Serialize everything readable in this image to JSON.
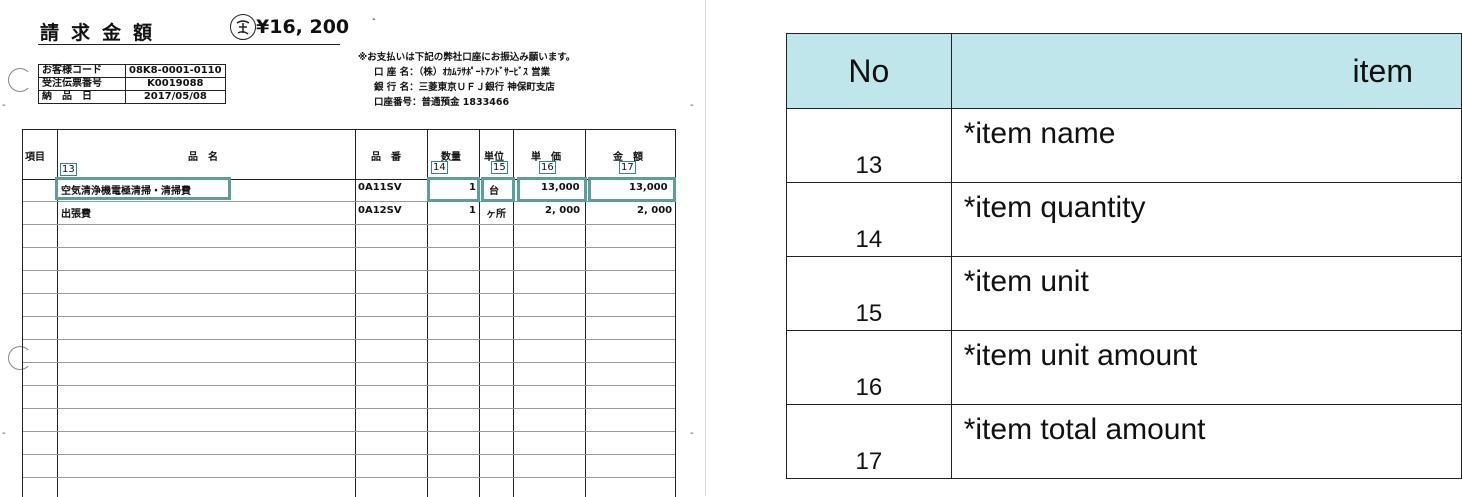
{
  "invoice": {
    "title": "請求金額",
    "stamp_text": "星ん",
    "amount": "¥16, 200",
    "info": [
      {
        "label": "お客様コード",
        "value": "08K8-0001-0110"
      },
      {
        "label": "受注伝票番号",
        "value": "K0019088"
      },
      {
        "label": "納　品　日",
        "value": "2017/05/08"
      }
    ],
    "payment_notice": "※お支払いは下記の弊社口座にお振込み願います。",
    "bank_lines": [
      "口 座 名：（株）ｵｶﾑﾗｻﾎﾟｰﾄｱﾝﾄﾞｻｰﾋﾞｽ 営業",
      "銀 行 名：三菱東京ＵＦＪ銀行 神保町支店",
      "口座番号：普通預金 1833466"
    ],
    "headers": {
      "item": "項目",
      "name": "品　名",
      "code": "品　番",
      "qty": "数量",
      "unit": "単位",
      "price": "単　価",
      "total": "金　額"
    },
    "markers": {
      "name": "13",
      "qty": "14",
      "unit": "15",
      "price": "16",
      "total": "17"
    },
    "rows": [
      {
        "name": "空気清浄機電極清掃・清掃費",
        "code": "0A11SV",
        "qty": "1",
        "unit": "台",
        "price": "13,000",
        "total": "13,000"
      },
      {
        "name": "出張費",
        "code": "0A12SV",
        "qty": "1",
        "unit": "ヶ所",
        "price": "2, 000",
        "total": "2, 000"
      }
    ]
  },
  "fields_table": {
    "headers": {
      "no": "No",
      "item": "item"
    },
    "rows": [
      {
        "no": "13",
        "item": "*item name"
      },
      {
        "no": "14",
        "item": "*item quantity"
      },
      {
        "no": "15",
        "item": "*item unit"
      },
      {
        "no": "16",
        "item": "*item unit amount"
      },
      {
        "no": "17",
        "item": "*item total amount"
      }
    ]
  },
  "colors": {
    "highlight": "#5c9e9a",
    "header_bg": "#bfe6ea"
  }
}
